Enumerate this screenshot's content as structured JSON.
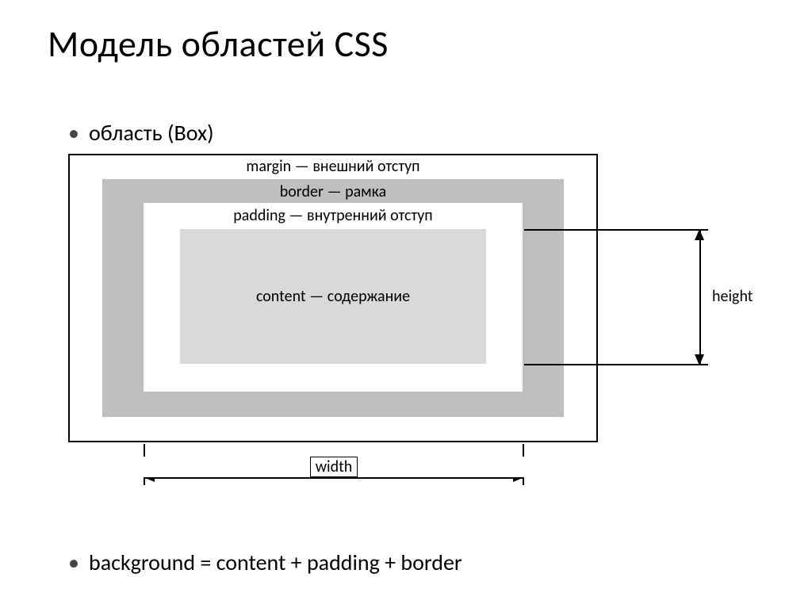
{
  "title": "Модель областей CSS",
  "bullets": {
    "b1": "область (Box)",
    "b2": "background = content + padding + border"
  },
  "box_labels": {
    "margin": "margin — внешний отступ",
    "border": "border — рамка",
    "padding": "padding — внутренний отступ",
    "content": "content — содержание"
  },
  "dim_labels": {
    "width": "width",
    "height": "height"
  }
}
